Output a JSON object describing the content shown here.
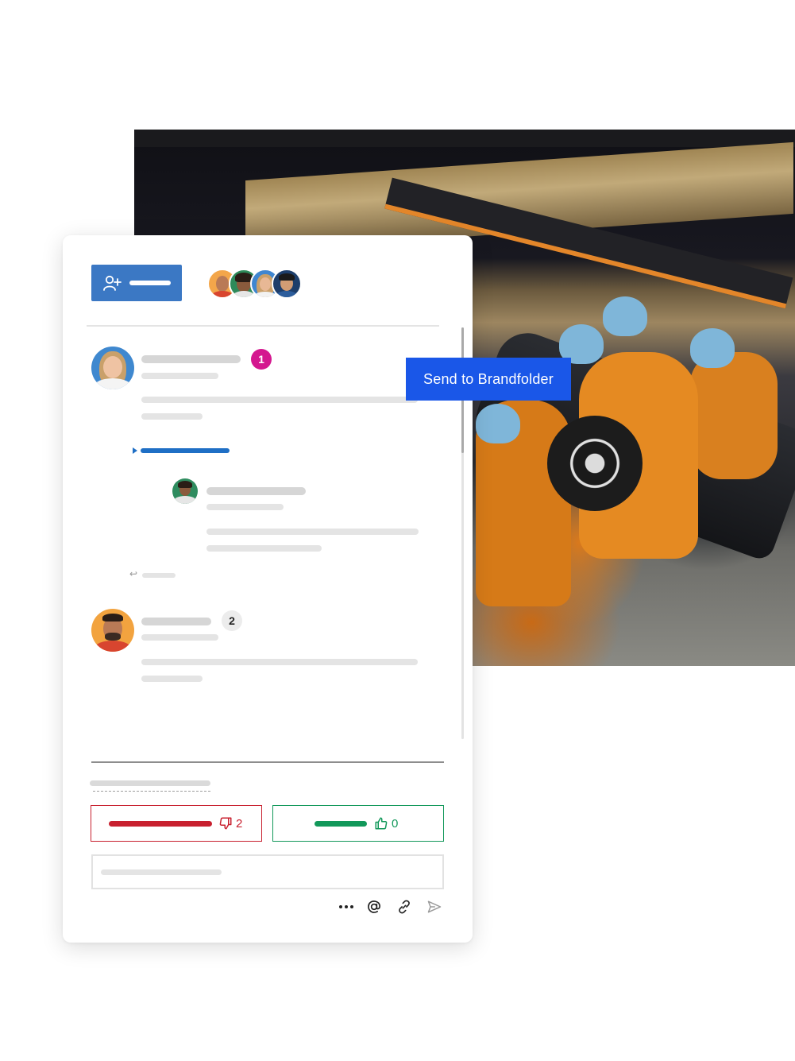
{
  "send_button": {
    "label": "Send to Brandfolder"
  },
  "comments": [
    {
      "id": "comment-1",
      "badge": "1"
    },
    {
      "id": "comment-2",
      "badge": "2"
    }
  ],
  "voting": {
    "downvote_count": "2",
    "upvote_count": "0"
  },
  "comment_input": {
    "value": "",
    "placeholder": ""
  },
  "colors": {
    "primary_blue": "#1a57e8",
    "invite_blue": "#3b78c4",
    "thread_blue": "#1f6fc5",
    "badge_pink": "#d4178f",
    "downvote_red": "#c8202f",
    "upvote_green": "#12985a"
  },
  "icons": [
    "add-user-icon",
    "thumbs-down-icon",
    "thumbs-up-icon",
    "more-options-icon",
    "mention-icon",
    "link-icon",
    "send-icon",
    "reply-arrow-icon",
    "expand-triangle-icon"
  ]
}
